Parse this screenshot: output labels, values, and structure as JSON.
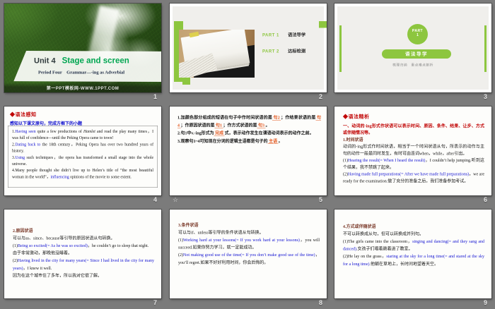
{
  "view": {
    "type": "powerpoint-slide-sorter",
    "background": "#7b7b7b"
  },
  "colors": {
    "accent_green": "#8dc63f",
    "title_green": "#00a651",
    "header_red": "#c00000",
    "english_blue": "#1313d2",
    "answer_orange": "#e2561c"
  },
  "slides": [
    {
      "number": "1",
      "unit": "Unit 4",
      "title": "Stage and screen",
      "subtitle": "Period Four　Grammar—-ing as Adverbial",
      "watermark": "第一PPT模板网-WWW.1PPT.COM"
    },
    {
      "number": "2",
      "items": [
        {
          "part": "PART 1",
          "label": "语法导学"
        },
        {
          "part": "PART 2",
          "label": "达标检测"
        }
      ]
    },
    {
      "number": "3",
      "part_word": "PART",
      "part_num": "1",
      "title": "语法导学",
      "subtitle": "梳理归纳　重点难点剖析"
    },
    {
      "number": "4",
      "header": "◆语法感知",
      "subheader": "感知以下课文原句，完成方框下的小题",
      "lines": [
        [
          {
            "t": "1."
          },
          {
            "t": "Having seen",
            "c": "b"
          },
          {
            "t": " quite a few productions of "
          },
          {
            "t": "Hamlet",
            "c": "i"
          },
          {
            "t": " and read the play many times，I was full of confidence—until the Peking Opera came to town!"
          }
        ],
        [
          {
            "t": "2."
          },
          {
            "t": "Dating back to",
            "c": "b"
          },
          {
            "t": " the 18th century，Peking Opera has over two hundred years of history."
          }
        ],
        [
          {
            "t": "3."
          },
          {
            "t": "Using",
            "c": "b"
          },
          {
            "t": " such techniques，the opera has transformed a small stage into the whole universe."
          }
        ],
        [
          {
            "t": "4.Many people thought she didn’t live up to Helen’s title of “the most beautiful woman in the world”，"
          },
          {
            "t": "influencing",
            "c": "b"
          },
          {
            "t": " opinions of the movie to some extent."
          }
        ]
      ]
    },
    {
      "number": "5",
      "star": "☆",
      "lines": [
        [
          {
            "t": "1.加颜色部分组成的短语在句子中作时间状语的是"
          },
          {
            "t": "句2",
            "c": "o"
          },
          {
            "t": "；作结果状语的是"
          },
          {
            "t": "句4",
            "c": "o"
          },
          {
            "t": "；作原因状语的是"
          },
          {
            "t": "句1",
            "c": "o"
          },
          {
            "t": "；作方式状语的是"
          },
          {
            "t": "句3",
            "c": "o"
          },
          {
            "t": "。"
          }
        ],
        [
          {
            "t": "2.句1中v.-ing形式为"
          },
          {
            "t": "完成",
            "c": "o"
          },
          {
            "t": "式，表示动作发生在谓语动词表示的动作之前。"
          }
        ],
        [
          {
            "t": "3.观察句1~4可知现在分词的逻辑主语都是句子的"
          },
          {
            "t": "主语",
            "c": "o"
          },
          {
            "t": "。"
          }
        ]
      ]
    },
    {
      "number": "6",
      "header": "◆语法精析",
      "lines": [
        [
          {
            "t": "一、动词的-ing形式作状语可以表示时间、原因、条件、结果、让步、方式或伴随情况等。",
            "c": "r"
          }
        ],
        [
          {
            "t": "1.时间状语",
            "c": "h"
          }
        ],
        [
          {
            "t": "动词的-ing形式作时间状语，相当于一个时间状语从句，所表示的动作与主句的动作一般是同时发生，有时可由连词when，while，after引出。"
          }
        ],
        [
          {
            "t": "(1)"
          },
          {
            "t": "Hearing the result(= When I heard the result)",
            "c": "b"
          },
          {
            "t": "，I couldn’t help jumping.听到这个结果，我不禁跳了起来。"
          }
        ],
        [
          {
            "t": "(2)"
          },
          {
            "t": "Having made full preparations(= After we have made full preparations)",
            "c": "b"
          },
          {
            "t": "，we are ready for the examination.做了充分的准备之后，我们准备参加考试。"
          }
        ]
      ]
    },
    {
      "number": "7",
      "lines": [
        [
          {
            "t": "2.原因状语",
            "c": "h"
          }
        ],
        [
          {
            "t": "可以与as、since、because等引导的原因状语从句转换。"
          }
        ],
        [
          {
            "t": "(1)"
          },
          {
            "t": "Being so excited(= As he was so excited)",
            "c": "b"
          },
          {
            "t": "，he couldn’t go to sleep that night."
          }
        ],
        [
          {
            "t": "由于非常激动，那晚他没睡着。"
          }
        ],
        [
          {
            "t": "(2)"
          },
          {
            "t": "Having lived in the city for many years(= Since I had lived in the city for many years)",
            "c": "b"
          },
          {
            "t": "，I knew it well."
          }
        ],
        [
          {
            "t": "因为在这个城市住了多年，所以我对它很了解。"
          }
        ]
      ]
    },
    {
      "number": "8",
      "lines": [
        [
          {
            "t": "3.条件状语",
            "c": "h"
          }
        ],
        [
          {
            "t": "可以与if、unless等引导的条件状语从句转换。"
          }
        ],
        [
          {
            "t": "(1)"
          },
          {
            "t": "Working hard at your lessons(= If you work hard at your lessons)",
            "c": "b"
          },
          {
            "t": "，you will succeed.如果你努力学习，就一定能成功。"
          }
        ],
        [
          {
            "t": "(2)"
          },
          {
            "t": "Not making good use of the time(= If you don’t make good use of the time)",
            "c": "b"
          },
          {
            "t": "，you’ll regret.如果不好好利用时间，你会后悔的。"
          }
        ]
      ]
    },
    {
      "number": "9",
      "lines": [
        [
          {
            "t": "4.方式或伴随状语",
            "c": "h"
          }
        ],
        [
          {
            "t": "不可以转换成从句，但可以转换成并列句。"
          }
        ],
        [
          {
            "t": "(1)The girls came into the classroom，"
          },
          {
            "t": "singing and dancing(= and they sang and danced)",
            "c": "b"
          },
          {
            "t": ".女孩子们唱着跳着进了教室。"
          }
        ],
        [
          {
            "t": "(2)He lay on the grass，"
          },
          {
            "t": "staring at the sky for a long time(= and stared at the sky for a long time)",
            "c": "b"
          },
          {
            "t": ".他躺在草地上，长时间地望着天空。"
          }
        ]
      ]
    }
  ]
}
